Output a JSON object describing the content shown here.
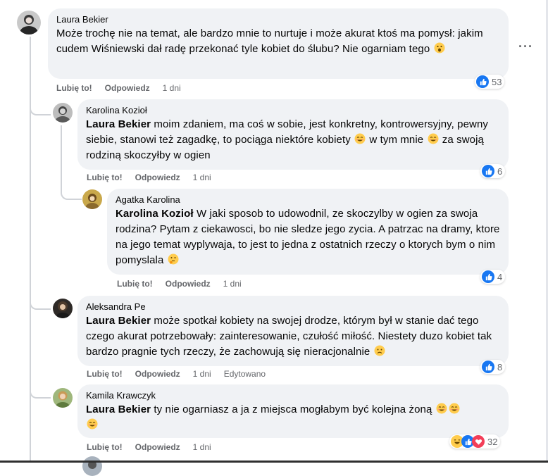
{
  "comments": [
    {
      "author": "Laura Bekier",
      "text": "Może trochę nie na temat, ale bardzo mnie to nurtuje i może akurat ktoś ma pomysł: jakim cudem Wiśniewski dał radę przekonać tyle kobiet do ślubu? Nie ogarniam tego",
      "like": "Lubię to!",
      "reply": "Odpowiedz",
      "time": "1 dni",
      "reactions": "53"
    },
    {
      "author": "Karolina Kozioł",
      "mention": "Laura Bekier",
      "text_a": "moim zdaniem, ma coś w sobie, jest konkretny, kontrowersyjny, pewny siebie, stanowi też zagadkę, to pociąga niektóre kobiety",
      "text_b": "w tym mnie",
      "text_c": "za swoją rodziną skoczyłby w ogien",
      "like": "Lubię to!",
      "reply": "Odpowiedz",
      "time": "1 dni",
      "reactions": "6"
    },
    {
      "author": "Agatka Karolina",
      "mention": "Karolina Kozioł",
      "text": "W jaki sposob to udowodnil, ze skoczylby w ogien za swoja rodzina? Pytam z ciekawosci, bo nie sledze jego zycia. A patrzac na dramy, ktore na jego temat wyplywaja, to jest to jedna z ostatnich rzeczy o ktorych bym o nim pomyslala",
      "like": "Lubię to!",
      "reply": "Odpowiedz",
      "time": "1 dni",
      "reactions": "4"
    },
    {
      "author": "Aleksandra Pe",
      "mention": "Laura Bekier",
      "text": "może spotkał kobiety na swojej drodze, którym był w stanie dać tego czego akurat potrzebowały: zainteresowanie, czułość miłość. Niestety duzo kobiet tak bardzo pragnie tych rzeczy, że zachowują się nieracjonalnie",
      "like": "Lubię to!",
      "reply": "Odpowiedz",
      "time": "1 dni",
      "edited": "Edytowano",
      "reactions": "8"
    },
    {
      "author": "Kamila Krawczyk",
      "mention": "Laura Bekier",
      "text": "ty nie ogarniasz a ja z miejsca mogłabym być kolejna żoną",
      "like": "Lubię to!",
      "reply": "Odpowiedz",
      "time": "1 dni",
      "reactions": "32"
    }
  ],
  "colors": {
    "like_blue": "#1877f2",
    "love_red": "#f33e58",
    "bubble": "#f0f2f5",
    "meta_grey": "#65676b"
  },
  "icons": [
    "more-icon",
    "like-reaction-icon",
    "haha-reaction-icon",
    "love-reaction-icon",
    "astonished-emoji",
    "smile-emoji",
    "thinking-emoji",
    "frown-emoji",
    "grin-emoji"
  ]
}
